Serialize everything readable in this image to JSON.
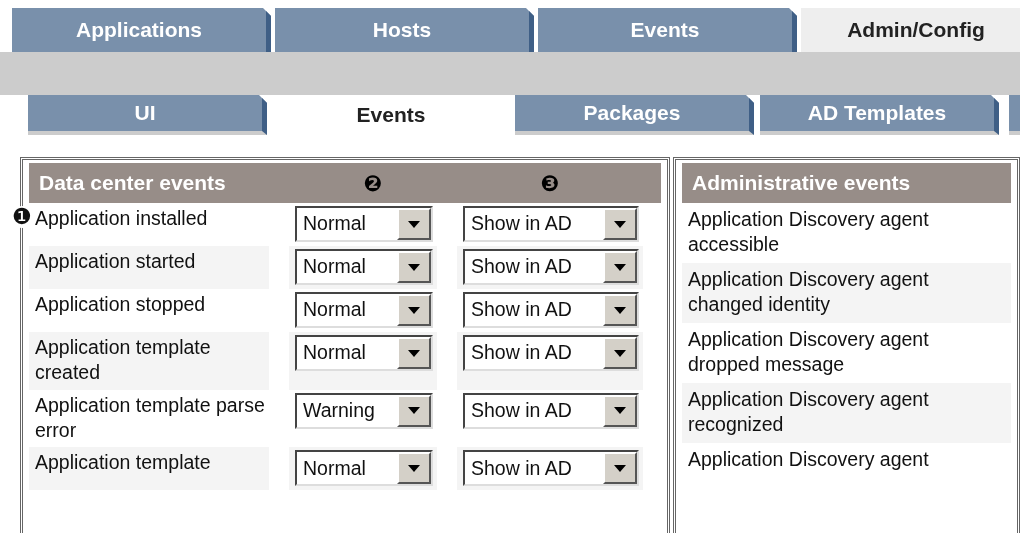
{
  "main_tabs": [
    {
      "label": "Applications",
      "selected": false
    },
    {
      "label": "Hosts",
      "selected": false
    },
    {
      "label": "Events",
      "selected": false
    },
    {
      "label": "Admin/Config",
      "selected": true
    }
  ],
  "sub_tabs": [
    {
      "label": "UI",
      "selected": false
    },
    {
      "label": "Events",
      "selected": true
    },
    {
      "label": "Packages",
      "selected": false
    },
    {
      "label": "AD Templates",
      "selected": false
    }
  ],
  "data_center_events": {
    "title": "Data center events",
    "column_2_marker": "❷",
    "column_3_marker": "❸",
    "row_marker": "❶",
    "rows": [
      {
        "name": "Application installed",
        "severity": "Normal",
        "display": "Show in AD"
      },
      {
        "name": "Application started",
        "severity": "Normal",
        "display": "Show in AD"
      },
      {
        "name": "Application stopped",
        "severity": "Normal",
        "display": "Show in AD"
      },
      {
        "name": "Application template created",
        "severity": "Normal",
        "display": "Show in AD"
      },
      {
        "name": "Application template parse error",
        "severity": "Warning",
        "display": "Show in AD"
      },
      {
        "name": "Application template",
        "severity": "Normal",
        "display": "Show in AD"
      }
    ]
  },
  "administrative_events": {
    "title": "Administrative events",
    "rows": [
      "Application Discovery agent accessible",
      "Application Discovery agent changed identity",
      "Application Discovery agent dropped message",
      "Application Discovery agent recognized",
      "Application Discovery agent"
    ]
  }
}
